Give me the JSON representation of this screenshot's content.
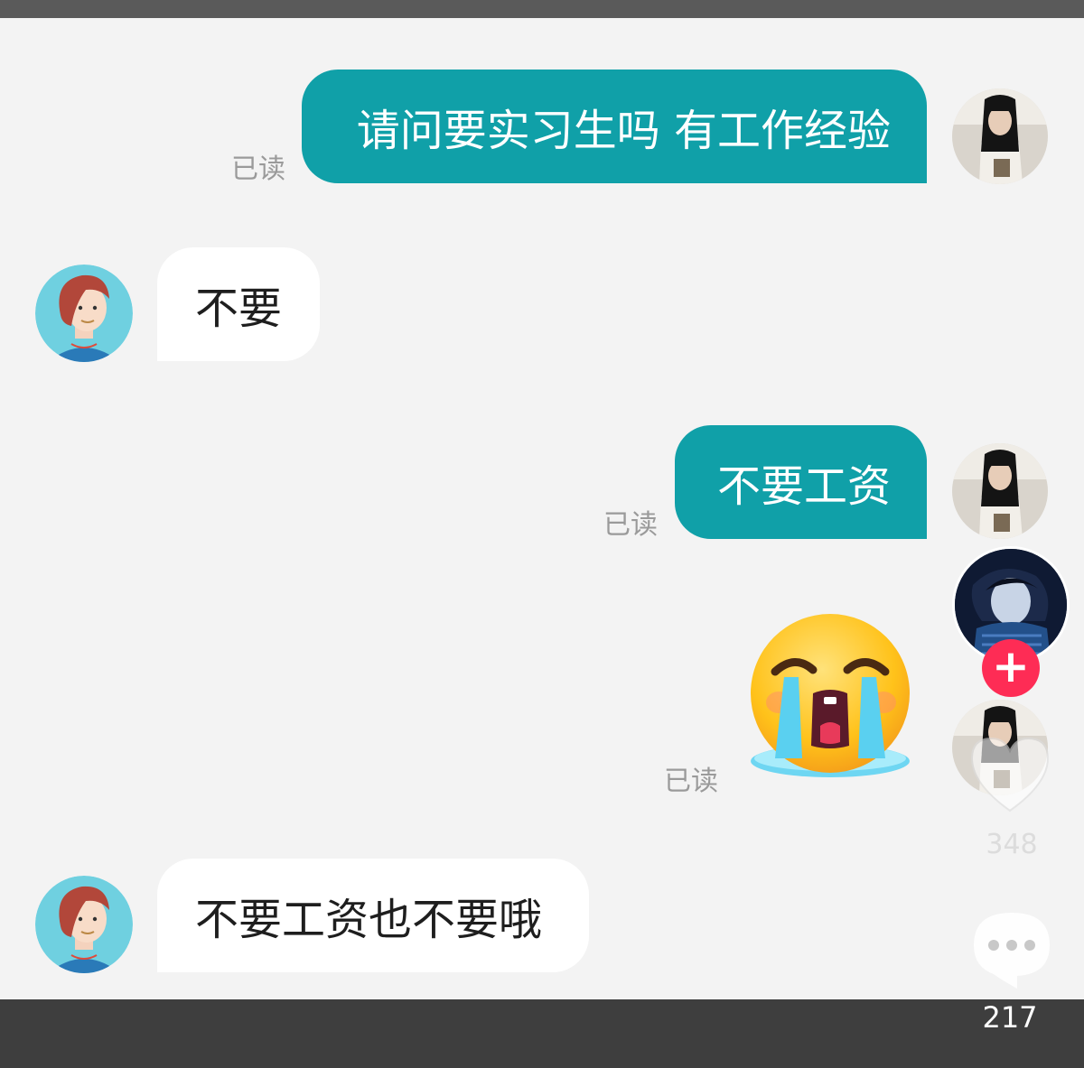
{
  "messages": [
    {
      "direction": "out",
      "text": "请问要实习生吗 有工作经验",
      "status": "已读"
    },
    {
      "direction": "in",
      "text": "不要"
    },
    {
      "direction": "out",
      "text": "不要工资",
      "status": "已读"
    },
    {
      "direction": "out",
      "emoji": "crying-face",
      "status": "已读"
    },
    {
      "direction": "in",
      "text": "不要工资也不要哦"
    }
  ],
  "sidebar": {
    "follow_label": "+",
    "like_count": "348",
    "comment_count": "217"
  },
  "colors": {
    "outgoing_bubble": "#10a0a8",
    "incoming_bubble": "#ffffff",
    "follow_button": "#fe2c55",
    "read_label": "#9a9a9a"
  },
  "icons": [
    "heart-icon",
    "comment-bubble-icon",
    "crying-face-emoji"
  ]
}
